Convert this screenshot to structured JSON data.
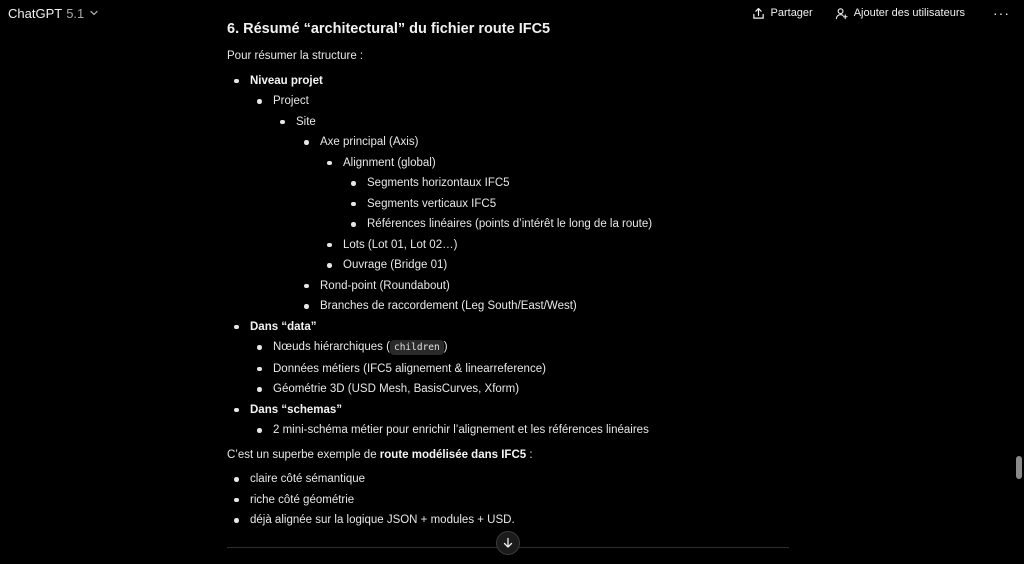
{
  "header": {
    "model_name": "ChatGPT",
    "model_version": "5.1",
    "share_label": "Partager",
    "add_users_label": "Ajouter des utilisateurs",
    "more_label": "···"
  },
  "article": {
    "heading": "6. Résumé “architectural” du fichier route IFC5",
    "intro": "Pour résumer la structure :",
    "tree": [
      {
        "text": "Niveau projet"
      },
      {
        "text": "Project"
      },
      {
        "text": "Site"
      },
      {
        "text": "Axe principal (Axis)"
      },
      {
        "text": "Alignment (global)"
      },
      {
        "text": "Segments horizontaux IFC5"
      },
      {
        "text": "Segments verticaux IFC5"
      },
      {
        "text": "Références linéaires (points d’intérêt le long de la route)"
      },
      {
        "text": "Lots (Lot 01, Lot 02…)"
      },
      {
        "text": "Ouvrage (Bridge 01)"
      },
      {
        "text": "Rond-point (Roundabout)"
      },
      {
        "text": "Branches de raccordement (Leg South/East/West)"
      },
      {
        "text": "Dans “data”"
      },
      {
        "text_before": "Nœuds hiérarchiques (",
        "code": "children",
        "text_after": ")"
      },
      {
        "text": "Données métiers (IFC5 alignement & linearreference)"
      },
      {
        "text": "Géométrie 3D (USD Mesh, BasisCurves, Xform)"
      },
      {
        "text": "Dans “schemas”"
      },
      {
        "text": "2 mini-schéma métier pour enrichir l’alignement et les références linéaires"
      }
    ],
    "summary_before": "C’est un superbe exemple de ",
    "summary_bold": "route modélisée dans IFC5",
    "summary_after": " :",
    "bullets": [
      "claire côté sémantique",
      "riche côté géométrie",
      "déjà alignée sur la logique JSON + modules + USD."
    ]
  },
  "colors": {
    "background": "#000000",
    "text": "#e8e8e8",
    "code_bg": "#2a2a2a",
    "scrollbar": "#8a8a8a"
  },
  "icons": {
    "share": "share-icon",
    "add_user": "add-user-icon",
    "more": "more-icon",
    "scroll_down": "arrow-down-icon",
    "model_chevron": "chevron-down-icon"
  }
}
